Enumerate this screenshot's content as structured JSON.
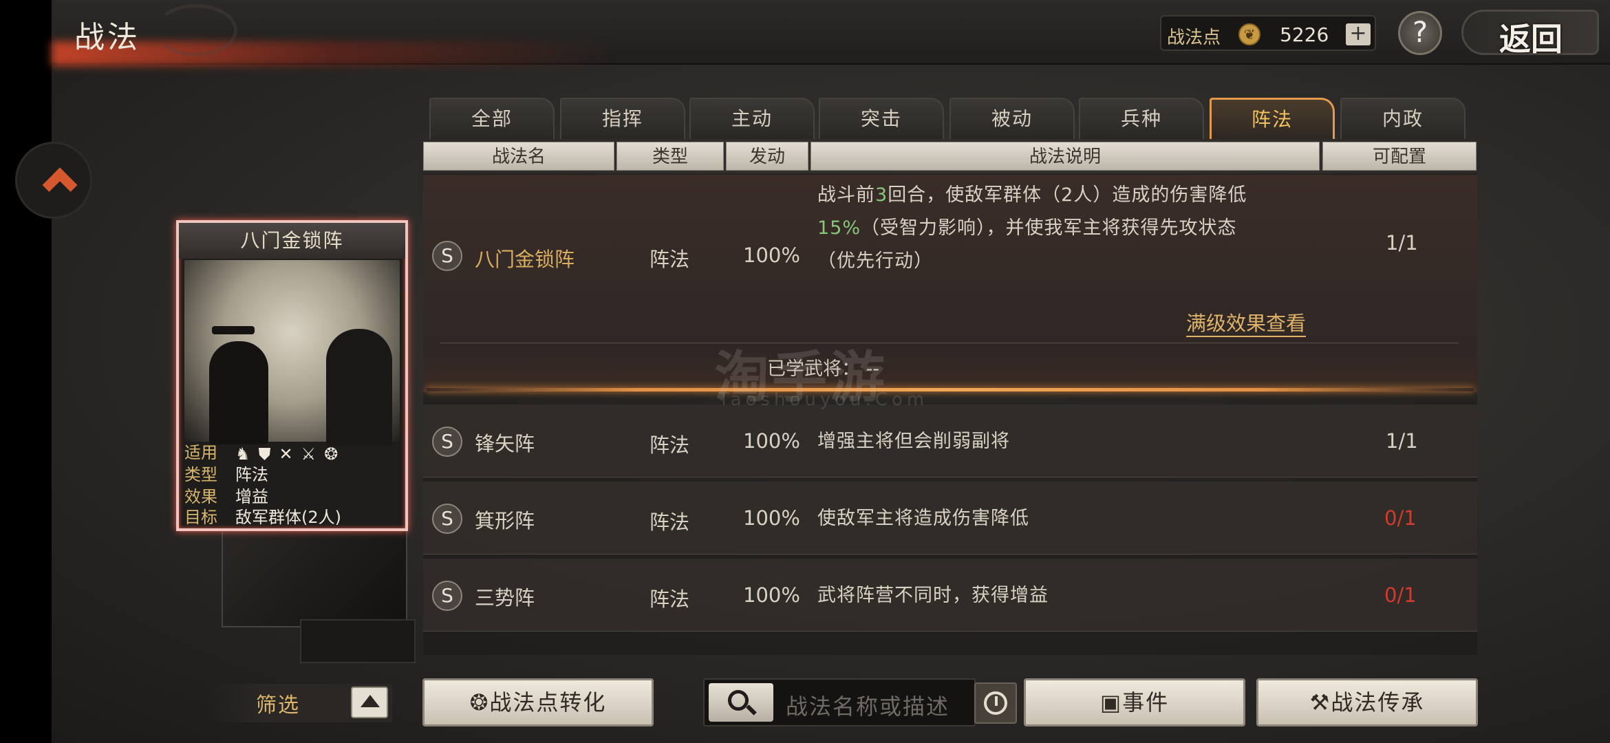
{
  "header": {
    "title": "战法",
    "points_label": "战法点",
    "points_value": "5226",
    "plus_label": "+",
    "help_label": "?",
    "back_label": "返回"
  },
  "tabs": [
    {
      "label": "全部",
      "active": false
    },
    {
      "label": "指挥",
      "active": false
    },
    {
      "label": "主动",
      "active": false
    },
    {
      "label": "突击",
      "active": false
    },
    {
      "label": "被动",
      "active": false
    },
    {
      "label": "兵种",
      "active": false
    },
    {
      "label": "阵法",
      "active": true
    },
    {
      "label": "内政",
      "active": false
    }
  ],
  "columns": {
    "name": "战法名",
    "type": "类型",
    "trigger": "发动",
    "desc": "战法说明",
    "config": "可配置"
  },
  "rows": [
    {
      "badge": "S",
      "name": "八门金锁阵",
      "type": "阵法",
      "trigger": "100%",
      "desc_line1_a": "战斗前",
      "desc_line1_hl": "3",
      "desc_line1_b": "回合，使敌军群体（2人）造成的伤害降低",
      "desc_line2_hl": "15%",
      "desc_line2_b": "（受智力影响），并使我军主将获得先攻状态",
      "desc_line3": "（优先行动）",
      "config": "1/1",
      "max_level_link": "满级效果查看",
      "learned_label": "已学武将：",
      "learned_value": "--"
    },
    {
      "badge": "S",
      "name": "锋矢阵",
      "type": "阵法",
      "trigger": "100%",
      "desc": "增强主将但会削弱副将",
      "config": "1/1"
    },
    {
      "badge": "S",
      "name": "箕形阵",
      "type": "阵法",
      "trigger": "100%",
      "desc": "使敌军主将造成伤害降低",
      "config": "0/1"
    },
    {
      "badge": "S",
      "name": "三势阵",
      "type": "阵法",
      "trigger": "100%",
      "desc": "武将阵营不同时，获得增益",
      "config": "0/1"
    }
  ],
  "watermark": {
    "main": "淘手游",
    "sub": "Taoshouyou.Com"
  },
  "card": {
    "name": "八门金锁阵",
    "apply_label": "适用",
    "apply_icons": "♞⛊✕⚔❂",
    "type_label": "类型",
    "type_value": "阵法",
    "effect_label": "效果",
    "effect_value": "增益",
    "target_label": "目标",
    "target_value": "敌军群体(2人)"
  },
  "bottom": {
    "filter_label": "筛选",
    "convert_label": "战法点转化",
    "search_placeholder": "战法名称或描述",
    "event_label": "事件",
    "inherit_label": "战法传承"
  },
  "colors": {
    "accent_gold": "#f2c35e",
    "highlight_green": "#88c77a",
    "warning_red": "#d23b2b",
    "selection_orange": "#e39145"
  }
}
